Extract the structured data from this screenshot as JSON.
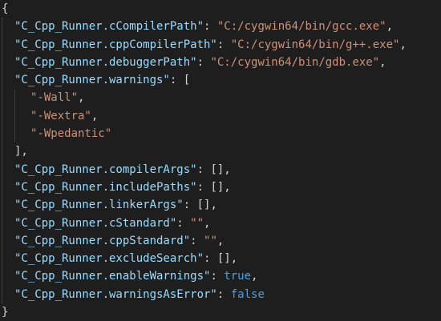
{
  "editor": {
    "open_brace": "{",
    "close_brace": "}",
    "entries": [
      {
        "key": "\"C_Cpp_Runner.cCompilerPath\"",
        "sep": ": ",
        "value": "\"C:/cygwin64/bin/gcc.exe\"",
        "value_kind": "string",
        "tail": ","
      },
      {
        "key": "\"C_Cpp_Runner.cppCompilerPath\"",
        "sep": ": ",
        "value": "\"C:/cygwin64/bin/g++.exe\"",
        "value_kind": "string",
        "tail": ","
      },
      {
        "key": "\"C_Cpp_Runner.debuggerPath\"",
        "sep": ": ",
        "value": "\"C:/cygwin64/bin/gdb.exe\"",
        "value_kind": "string",
        "tail": ","
      },
      {
        "key": "\"C_Cpp_Runner.warnings\"",
        "sep": ": ",
        "value": "[",
        "value_kind": "punc",
        "tail": ""
      },
      {
        "key": "\"C_Cpp_Runner.compilerArgs\"",
        "sep": ": ",
        "value": "[]",
        "value_kind": "punc",
        "tail": ","
      },
      {
        "key": "\"C_Cpp_Runner.includePaths\"",
        "sep": ": ",
        "value": "[]",
        "value_kind": "punc",
        "tail": ","
      },
      {
        "key": "\"C_Cpp_Runner.linkerArgs\"",
        "sep": ": ",
        "value": "[]",
        "value_kind": "punc",
        "tail": ","
      },
      {
        "key": "\"C_Cpp_Runner.cStandard\"",
        "sep": ": ",
        "value": "\"\"",
        "value_kind": "string",
        "tail": ","
      },
      {
        "key": "\"C_Cpp_Runner.cppStandard\"",
        "sep": ": ",
        "value": "\"\"",
        "value_kind": "string",
        "tail": ","
      },
      {
        "key": "\"C_Cpp_Runner.excludeSearch\"",
        "sep": ": ",
        "value": "[]",
        "value_kind": "punc",
        "tail": ","
      },
      {
        "key": "\"C_Cpp_Runner.enableWarnings\"",
        "sep": ": ",
        "value": "true",
        "value_kind": "keyword",
        "tail": ","
      },
      {
        "key": "\"C_Cpp_Runner.warningsAsError\"",
        "sep": ": ",
        "value": "false",
        "value_kind": "keyword",
        "tail": ""
      }
    ],
    "warnings_items": [
      {
        "value": "\"-Wall\"",
        "tail": ","
      },
      {
        "value": "\"-Wextra\"",
        "tail": ","
      },
      {
        "value": "\"-Wpedantic\"",
        "tail": ""
      }
    ],
    "warnings_close": "],"
  },
  "colors": {
    "background": "#1e1e1e",
    "key": "#9cdcfe",
    "string": "#ce9178",
    "keyword": "#569cd6",
    "punctuation": "#d4d4d4",
    "indent_guide": "#404040"
  }
}
